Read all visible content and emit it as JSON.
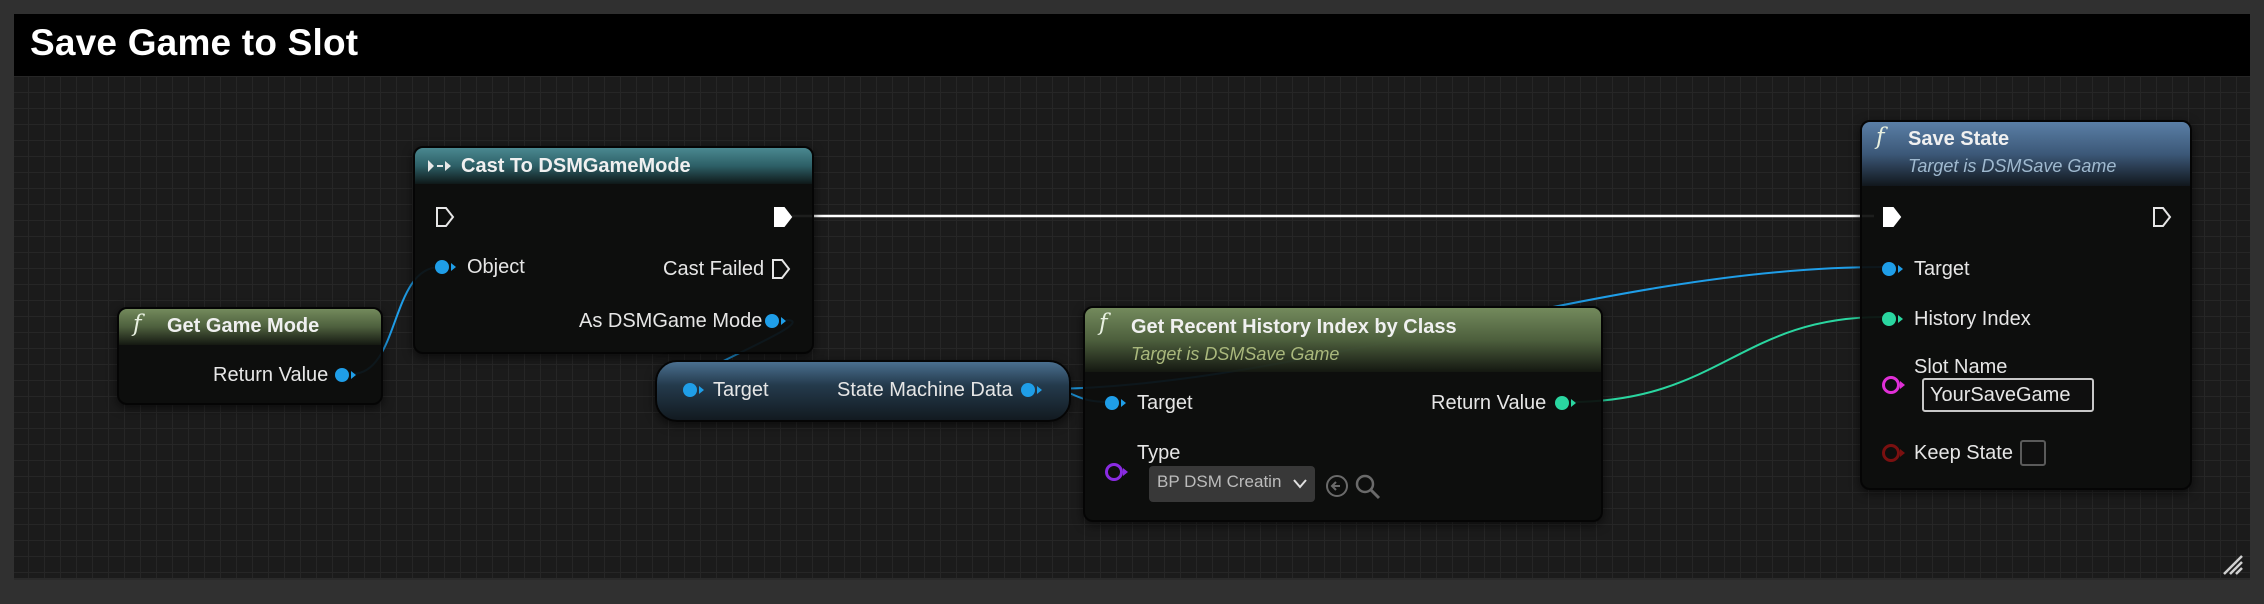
{
  "graph": {
    "title": "Save Game to Slot"
  },
  "nodes": {
    "get_game_mode": {
      "icon": "f",
      "title": "Get Game Mode",
      "pins": {
        "return_value": "Return Value"
      }
    },
    "cast": {
      "title": "Cast To DSMGameMode",
      "pins": {
        "object": "Object",
        "cast_failed": "Cast Failed",
        "as_dsm": "As DSMGame Mode"
      }
    },
    "reroute": {
      "pins": {
        "target": "Target",
        "state_machine_data": "State Machine Data"
      }
    },
    "get_recent": {
      "icon": "f",
      "title": "Get Recent History Index by Class",
      "subtitle": "Target is DSMSave Game",
      "pins": {
        "target": "Target",
        "return_value": "Return Value",
        "type": "Type"
      },
      "type_value": "BP DSM Creatin"
    },
    "save_state": {
      "icon": "f",
      "title": "Save State",
      "subtitle": "Target is DSMSave Game",
      "pins": {
        "target": "Target",
        "history_index": "History Index",
        "slot_name": "Slot Name",
        "keep_state": "Keep State"
      },
      "slot_name_value": "YourSaveGame",
      "keep_state_checked": false
    }
  },
  "colors": {
    "object_pin": "#1f9ee8",
    "int_pin": "#2ad6a0",
    "class_pin": "#8a2be2",
    "string_pin": "#e02fd6",
    "bool_pin": "#7a1010",
    "exec_wire": "#ffffff"
  },
  "icons": [
    "function-icon",
    "cast-icon",
    "exec-pin-icon",
    "chevron-down-icon",
    "use-selected-icon",
    "browse-icon",
    "resize-icon"
  ]
}
